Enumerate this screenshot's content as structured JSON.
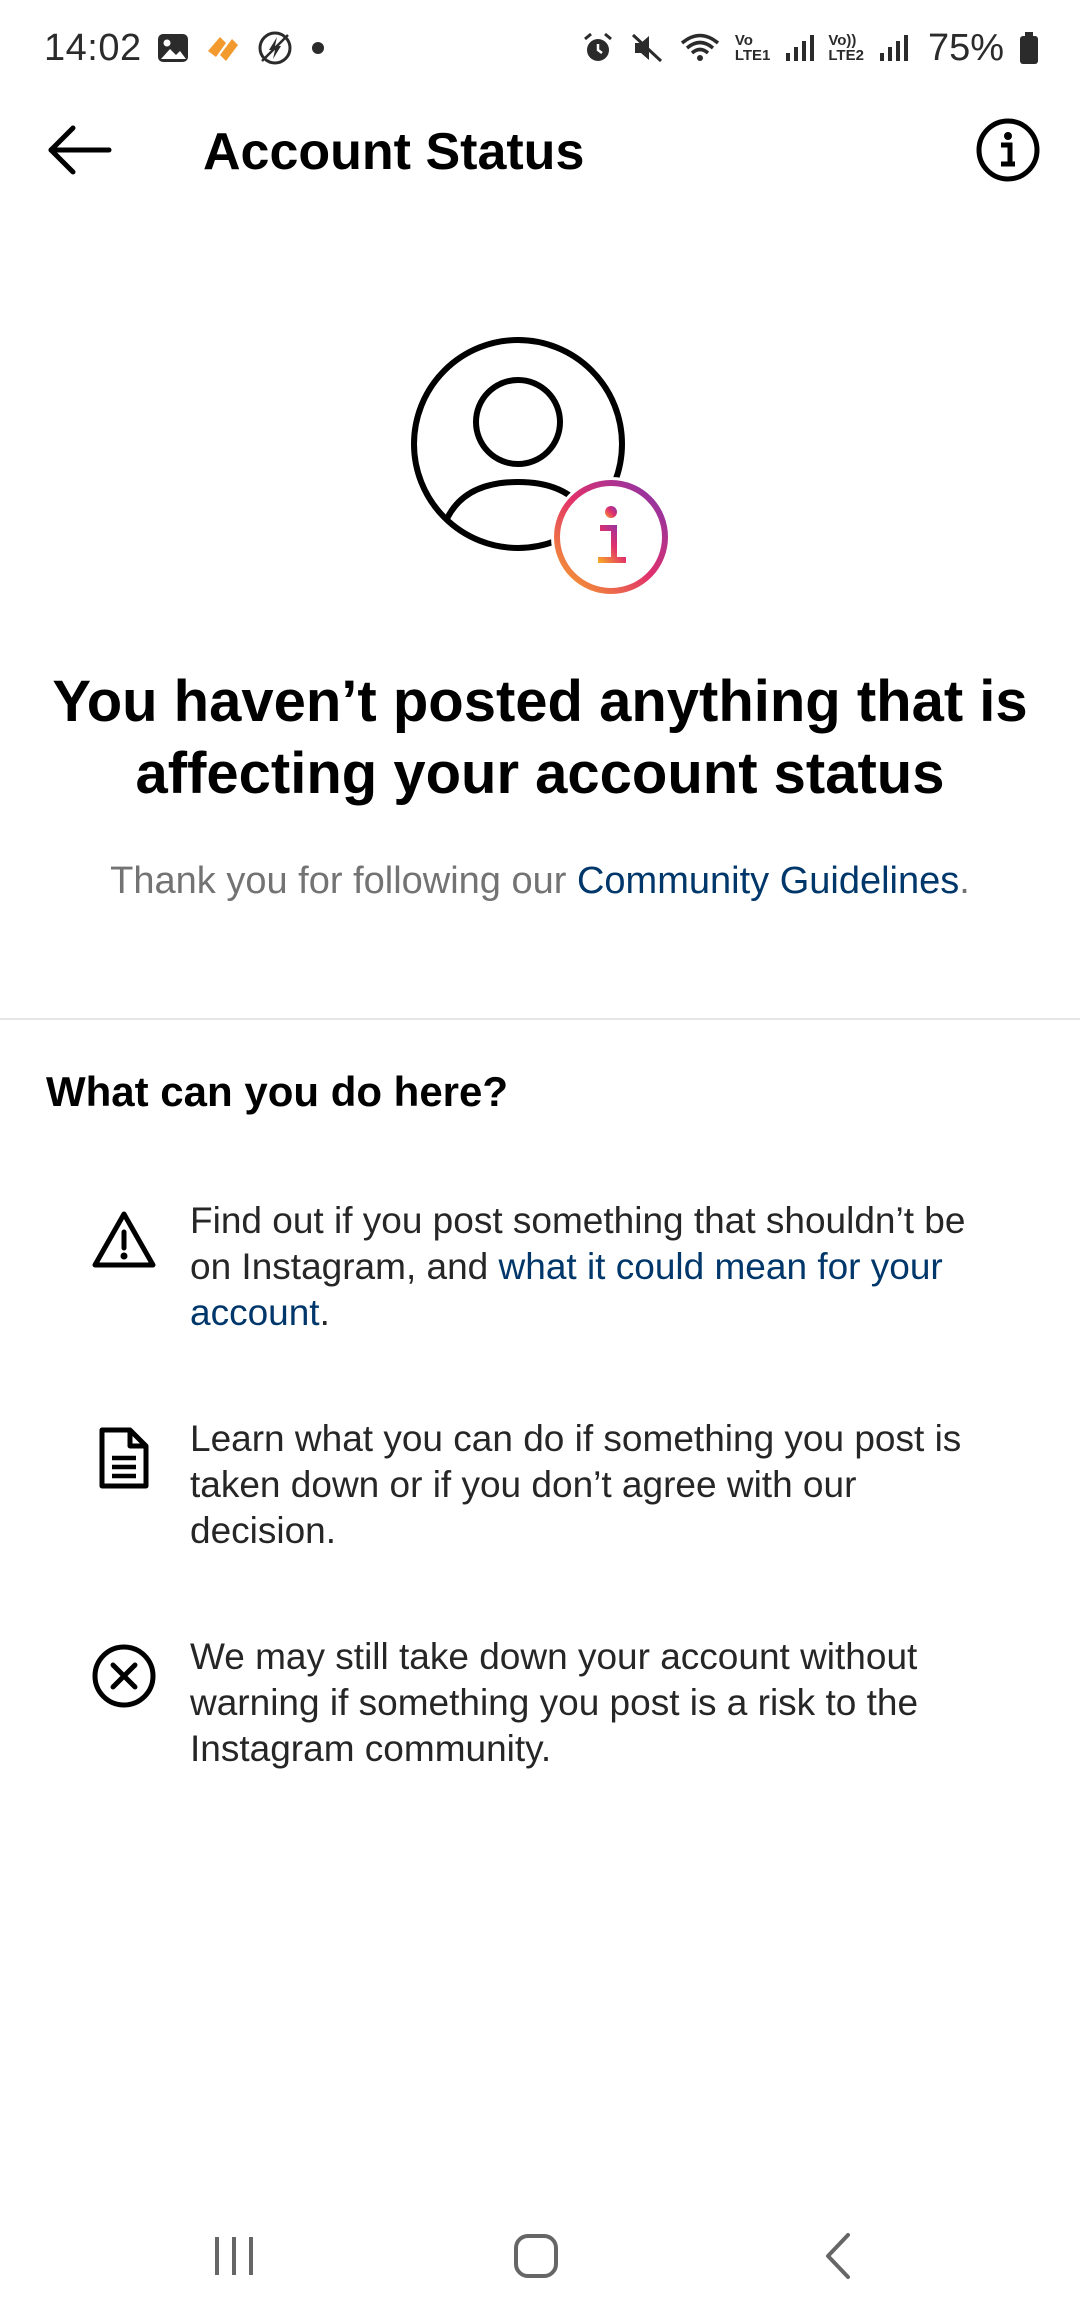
{
  "status_bar": {
    "time": "14:02",
    "battery": "75%",
    "sim1_label_top": "Vo",
    "sim1_label_bottom": "LTE1",
    "sim2_label_top": "Vo))",
    "sim2_label_bottom": "LTE2",
    "icons": [
      "gallery-icon",
      "app-notification-icon",
      "data-saver-icon",
      "dot-icon",
      "alarm-icon",
      "mute-icon",
      "wifi-icon",
      "signal-icon",
      "signal-icon",
      "battery-icon"
    ]
  },
  "header": {
    "title": "Account Status",
    "back_icon": "arrow-left-icon",
    "info_icon": "info-icon"
  },
  "hero": {
    "headline": "You haven’t posted anything that is affecting your account status",
    "subtext_prefix": "Thank you for following our ",
    "subtext_link": "Community Guidelines",
    "subtext_suffix": ".",
    "icon": "account-status-icon",
    "accent_gradient": [
      "#f7a629",
      "#e1306c",
      "#8134af"
    ]
  },
  "section": {
    "title": "What can you do here?",
    "items": [
      {
        "icon": "warning-icon",
        "text": "Find out if you post something that shouldn’t be on Instagram, and ",
        "link": "what it could mean for your account",
        "suffix": "."
      },
      {
        "icon": "document-icon",
        "text": "Learn what you can do if something you post is taken down or if you don’t agree with our decision."
      },
      {
        "icon": "circle-x-icon",
        "text": "We may still take down your account without warning if something you post is a risk to the Instagram community."
      }
    ]
  },
  "nav_bar": {
    "icons": [
      "recent-apps-icon",
      "home-icon",
      "back-icon"
    ]
  },
  "colors": {
    "link": "#00376b",
    "secondary_text": "#737373",
    "divider": "#e6e6e6"
  }
}
